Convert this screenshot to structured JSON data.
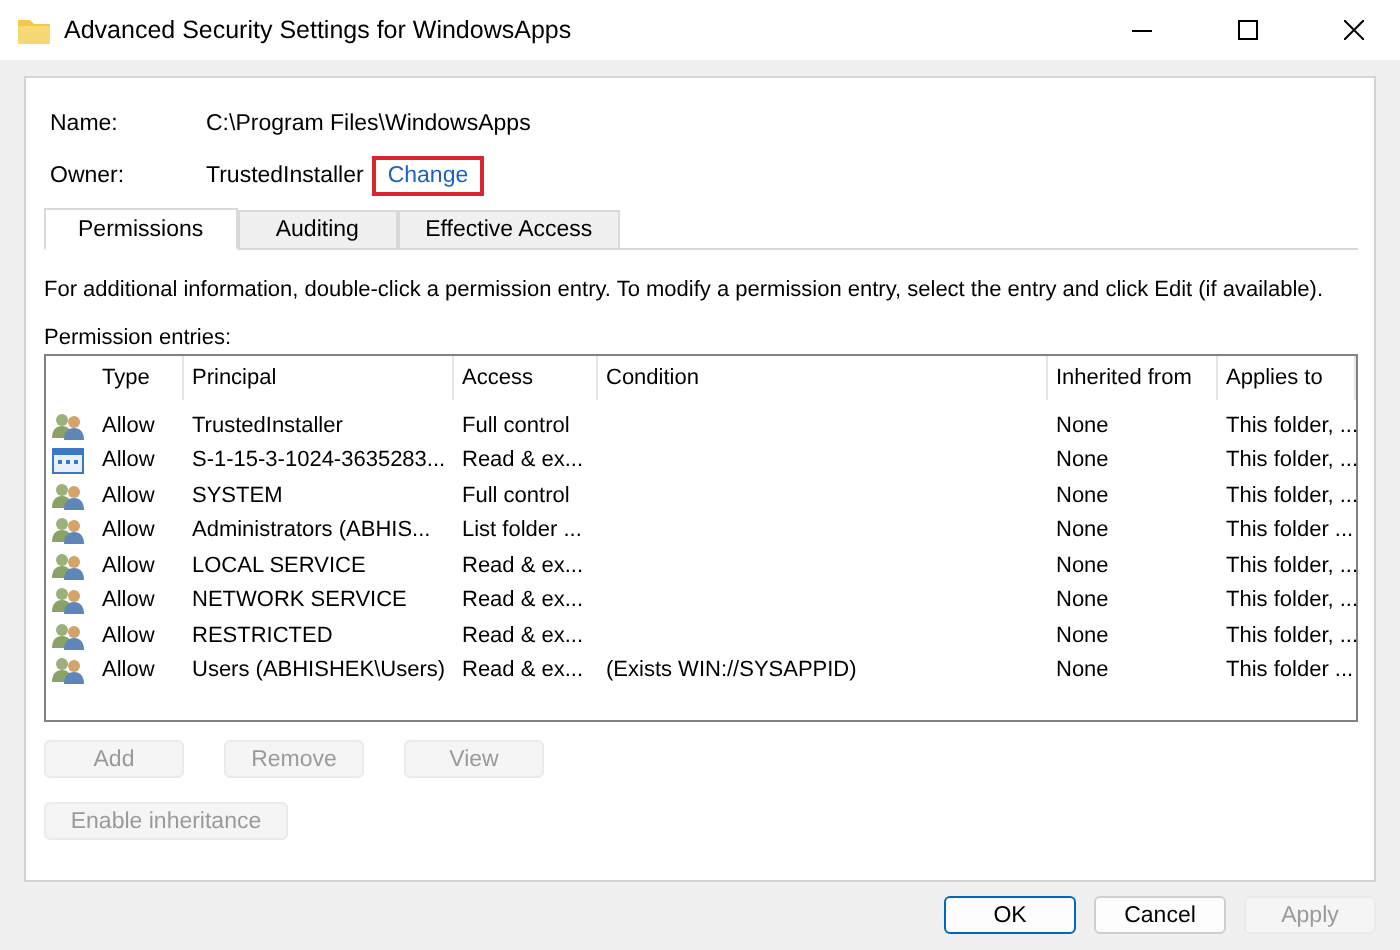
{
  "window": {
    "title": "Advanced Security Settings for WindowsApps"
  },
  "name_field": {
    "label": "Name:",
    "value": "C:\\Program Files\\WindowsApps"
  },
  "owner_field": {
    "label": "Owner:",
    "value": "TrustedInstaller",
    "link": "Change",
    "highlighted": true
  },
  "tabs": [
    {
      "label": "Permissions",
      "selected": true
    },
    {
      "label": "Auditing",
      "selected": false
    },
    {
      "label": "Effective Access",
      "selected": false
    }
  ],
  "info_text": "For additional information, double-click a permission entry. To modify a permission entry, select the entry and click Edit (if available).",
  "entries_label": "Permission entries:",
  "table": {
    "columns": [
      "Type",
      "Principal",
      "Access",
      "Condition",
      "Inherited from",
      "Applies to"
    ],
    "rows": [
      {
        "kind": "group",
        "cells": [
          "Allow",
          "TrustedInstaller",
          "Full control",
          "",
          "None",
          "This folder, ..."
        ]
      },
      {
        "kind": "package",
        "cells": [
          "Allow",
          "S-1-15-3-1024-3635283...",
          "Read & ex...",
          "",
          "None",
          "This folder, ..."
        ]
      },
      {
        "kind": "group",
        "cells": [
          "Allow",
          "SYSTEM",
          "Full control",
          "",
          "None",
          "This folder, ..."
        ]
      },
      {
        "kind": "group",
        "cells": [
          "Allow",
          "Administrators (ABHIS...",
          "List folder ...",
          "",
          "None",
          "This folder ..."
        ]
      },
      {
        "kind": "group",
        "cells": [
          "Allow",
          "LOCAL SERVICE",
          "Read & ex...",
          "",
          "None",
          "This folder, ..."
        ]
      },
      {
        "kind": "group",
        "cells": [
          "Allow",
          "NETWORK SERVICE",
          "Read & ex...",
          "",
          "None",
          "This folder, ..."
        ]
      },
      {
        "kind": "group",
        "cells": [
          "Allow",
          "RESTRICTED",
          "Read & ex...",
          "",
          "None",
          "This folder, ..."
        ]
      },
      {
        "kind": "group",
        "cells": [
          "Allow",
          "Users (ABHISHEK\\Users)",
          "Read & ex...",
          "(Exists WIN://SYSAPPID)",
          "None",
          "This folder ..."
        ]
      }
    ]
  },
  "entry_buttons": [
    {
      "label": "Add",
      "disabled": true
    },
    {
      "label": "Remove",
      "disabled": true
    },
    {
      "label": "View",
      "disabled": true
    }
  ],
  "inheritance_button": {
    "label": "Enable inheritance",
    "disabled": true
  },
  "dialog_buttons": [
    {
      "label": "OK",
      "disabled": false,
      "default": true
    },
    {
      "label": "Cancel",
      "disabled": false,
      "default": false
    },
    {
      "label": "Apply",
      "disabled": true,
      "default": false
    }
  ]
}
